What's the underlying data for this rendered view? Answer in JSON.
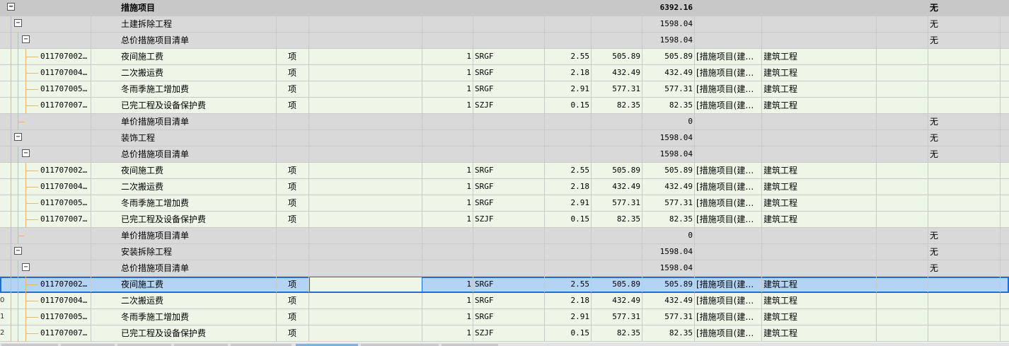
{
  "rows": [
    {
      "type": "top",
      "level": 0,
      "toggle": "−",
      "name": "措施项目",
      "total": "6392.16",
      "ref": "无"
    },
    {
      "type": "group",
      "level": 1,
      "toggle": "−",
      "name": "土建拆除工程",
      "total": "1598.04",
      "ref": "无"
    },
    {
      "type": "group",
      "level": 2,
      "toggle": "−",
      "name": "总价措施项目清单",
      "total": "1598.04",
      "ref": "无"
    },
    {
      "type": "item",
      "level": 3,
      "code": "011707002…",
      "name": "夜间施工费",
      "unit": "项",
      "qty": "1",
      "base": "SRGF",
      "rate": "2.55",
      "price": "505.89",
      "total": "505.89",
      "cat": "[措施项目(建…",
      "prof": "建筑工程"
    },
    {
      "type": "item",
      "level": 3,
      "code": "011707004…",
      "name": "二次搬运费",
      "unit": "项",
      "qty": "1",
      "base": "SRGF",
      "rate": "2.18",
      "price": "432.49",
      "total": "432.49",
      "cat": "[措施项目(建…",
      "prof": "建筑工程"
    },
    {
      "type": "item",
      "level": 3,
      "code": "011707005…",
      "name": "冬雨季施工增加费",
      "unit": "项",
      "qty": "1",
      "base": "SRGF",
      "rate": "2.91",
      "price": "577.31",
      "total": "577.31",
      "cat": "[措施项目(建…",
      "prof": "建筑工程"
    },
    {
      "type": "item",
      "level": 3,
      "code": "011707007…",
      "name": "已完工程及设备保护费",
      "unit": "项",
      "qty": "1",
      "base": "SZJF",
      "rate": "0.15",
      "price": "82.35",
      "total": "82.35",
      "cat": "[措施项目(建…",
      "prof": "建筑工程"
    },
    {
      "type": "group",
      "level": 2,
      "toggle": "",
      "name": "单价措施项目清单",
      "total": "0",
      "ref": "无"
    },
    {
      "type": "group",
      "level": 1,
      "toggle": "−",
      "name": "装饰工程",
      "total": "1598.04",
      "ref": "无"
    },
    {
      "type": "group",
      "level": 2,
      "toggle": "−",
      "name": "总价措施项目清单",
      "total": "1598.04",
      "ref": "无"
    },
    {
      "type": "item",
      "level": 3,
      "code": "011707002…",
      "name": "夜间施工费",
      "unit": "项",
      "qty": "1",
      "base": "SRGF",
      "rate": "2.55",
      "price": "505.89",
      "total": "505.89",
      "cat": "[措施项目(建…",
      "prof": "建筑工程"
    },
    {
      "type": "item",
      "level": 3,
      "code": "011707004…",
      "name": "二次搬运费",
      "unit": "项",
      "qty": "1",
      "base": "SRGF",
      "rate": "2.18",
      "price": "432.49",
      "total": "432.49",
      "cat": "[措施项目(建…",
      "prof": "建筑工程"
    },
    {
      "type": "item",
      "level": 3,
      "code": "011707005…",
      "name": "冬雨季施工增加费",
      "unit": "项",
      "qty": "1",
      "base": "SRGF",
      "rate": "2.91",
      "price": "577.31",
      "total": "577.31",
      "cat": "[措施项目(建…",
      "prof": "建筑工程"
    },
    {
      "type": "item",
      "level": 3,
      "code": "011707007…",
      "name": "已完工程及设备保护费",
      "unit": "项",
      "qty": "1",
      "base": "SZJF",
      "rate": "0.15",
      "price": "82.35",
      "total": "82.35",
      "cat": "[措施项目(建…",
      "prof": "建筑工程"
    },
    {
      "type": "group",
      "level": 2,
      "toggle": "",
      "name": "单价措施项目清单",
      "total": "0",
      "ref": "无"
    },
    {
      "type": "group",
      "level": 1,
      "toggle": "−",
      "name": "安装拆除工程",
      "total": "1598.04",
      "ref": "无"
    },
    {
      "type": "group",
      "level": 2,
      "toggle": "−",
      "name": "总价措施项目清单",
      "total": "1598.04",
      "ref": "无"
    },
    {
      "type": "item",
      "level": 3,
      "selected": true,
      "code": "011707002…",
      "name": "夜间施工费",
      "unit": "项",
      "qty": "1",
      "base": "SRGF",
      "rate": "2.55",
      "price": "505.89",
      "total": "505.89",
      "cat": "[措施项目(建…",
      "prof": "建筑工程"
    },
    {
      "type": "item",
      "level": 3,
      "rownum": "0",
      "code": "011707004…",
      "name": "二次搬运费",
      "unit": "项",
      "qty": "1",
      "base": "SRGF",
      "rate": "2.18",
      "price": "432.49",
      "total": "432.49",
      "cat": "[措施项目(建…",
      "prof": "建筑工程"
    },
    {
      "type": "item",
      "level": 3,
      "rownum": "1",
      "code": "011707005…",
      "name": "冬雨季施工增加费",
      "unit": "项",
      "qty": "1",
      "base": "SRGF",
      "rate": "2.91",
      "price": "577.31",
      "total": "577.31",
      "cat": "[措施项目(建…",
      "prof": "建筑工程"
    },
    {
      "type": "item",
      "level": 3,
      "rownum": "2",
      "code": "011707007…",
      "name": "已完工程及设备保护费",
      "unit": "项",
      "qty": "1",
      "base": "SZJF",
      "rate": "0.15",
      "price": "82.35",
      "total": "82.35",
      "cat": "[措施项目(建…",
      "prof": "建筑工程"
    }
  ],
  "colors": {
    "item_bg": "#eef6e8",
    "group_bg": "#d9d9d9",
    "selected_bg": "#b3d4f3",
    "tree_line": "#e8b86a",
    "focus": "#1f6fd1"
  }
}
